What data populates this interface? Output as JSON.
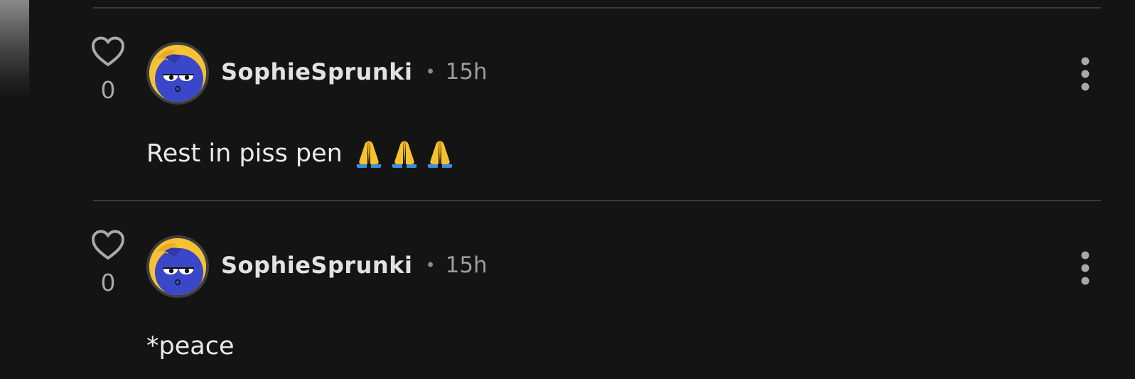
{
  "colors": {
    "background": "#141414",
    "divider": "#3a3a3a",
    "username": "#e2e2e2",
    "muted": "#9c9c9c",
    "avatar_ring": "#f5c234",
    "avatar_face": "#3a47c9"
  },
  "comments": [
    {
      "likes": "0",
      "like_icon": "heart-outline-icon",
      "author": "SophieSprunki",
      "separator": "•",
      "time": "15h",
      "menu_icon": "kebab-menu-icon",
      "text": "Rest in piss pen",
      "emojis": [
        "folded-hands-icon",
        "folded-hands-icon",
        "folded-hands-icon"
      ]
    },
    {
      "likes": "0",
      "like_icon": "heart-outline-icon",
      "author": "SophieSprunki",
      "separator": "•",
      "time": "15h",
      "menu_icon": "kebab-menu-icon",
      "text": "*peace",
      "emojis": []
    }
  ]
}
